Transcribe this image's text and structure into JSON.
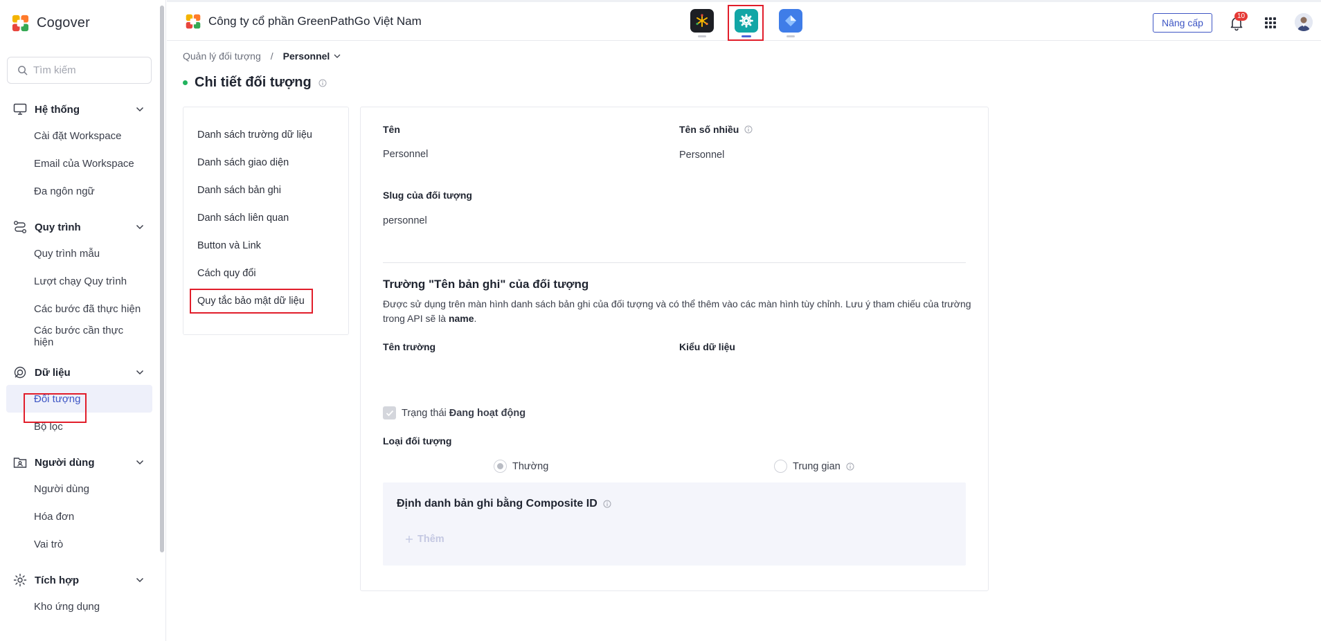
{
  "brand": {
    "name": "Cogover"
  },
  "search": {
    "placeholder": "Tìm kiếm"
  },
  "sidebar": {
    "groups": [
      {
        "title": "Hệ thống",
        "icon": "monitor-icon",
        "items": [
          "Cài đặt Workspace",
          "Email của Workspace",
          "Đa ngôn ngữ"
        ]
      },
      {
        "title": "Quy trình",
        "icon": "workflow-icon",
        "items": [
          "Quy trình mẫu",
          "Lượt chạy Quy trình",
          "Các bước đã thực hiện",
          "Các bước cần thực hiện"
        ]
      },
      {
        "title": "Dữ liệu",
        "icon": "data-icon",
        "items": [
          "Đối tượng",
          "Bộ lọc"
        ]
      },
      {
        "title": "Người dùng",
        "icon": "user-folder-icon",
        "items": [
          "Người dùng",
          "Hóa đơn",
          "Vai trò"
        ]
      },
      {
        "title": "Tích hợp",
        "icon": "integration-icon",
        "items": [
          "Kho ứng dụng"
        ]
      }
    ],
    "active_item": "Đối tượng"
  },
  "header": {
    "company": "Công ty cổ phần GreenPathGo Việt Nam",
    "apps": [
      "app-cluster-icon",
      "settings-app-icon",
      "diamond-app-icon"
    ],
    "selected_app": "settings-app-icon",
    "upgrade_label": "Nâng cấp",
    "notification_count": "10"
  },
  "breadcrumb": {
    "parent": "Quản lý đối tượng",
    "separator": "/",
    "current": "Personnel"
  },
  "page": {
    "title": "Chi tiết đối tượng"
  },
  "tabs": [
    "Danh sách trường dữ liệu",
    "Danh sách giao diện",
    "Danh sách bản ghi",
    "Danh sách liên quan",
    "Button và Link",
    "Cách quy đổi",
    "Quy tắc bảo mật dữ liệu"
  ],
  "detail": {
    "name_label": "Tên",
    "name_value": "Personnel",
    "plural_label": "Tên số nhiều",
    "plural_value": "Personnel",
    "slug_label": "Slug của đối tượng",
    "slug_value": "personnel",
    "record_name_title": "Trường \"Tên bản ghi\" của đối tượng",
    "record_name_desc": "Được sử dụng trên màn hình danh sách bản ghi của đối tượng và có thể thêm vào các màn hình tùy chỉnh. Lưu ý tham chiếu của trường trong API sẽ là",
    "record_name_api": "name",
    "record_name_end": ".",
    "field_name_label": "Tên trường",
    "data_type_label": "Kiểu dữ liệu",
    "status_prefix": "Trạng thái",
    "status_value": "Đang hoạt động",
    "object_type_label": "Loại đối tượng",
    "type_normal": "Thường",
    "type_intermediate": "Trung gian",
    "composite_title": "Định danh bản ghi bằng Composite ID",
    "add_label": "Thêm"
  }
}
